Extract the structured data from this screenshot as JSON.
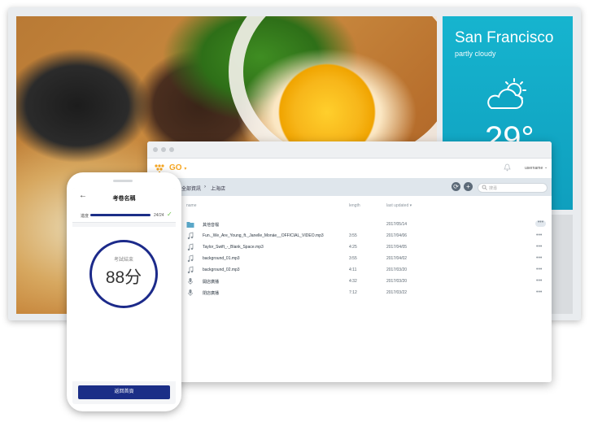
{
  "weather": {
    "city": "San Francisco",
    "condition": "partly cloudy",
    "temperature": "29°",
    "icon": "partly-cloudy-icon"
  },
  "window": {
    "app_name": "GO",
    "username": "username",
    "breadcrumb": [
      "全部資訊",
      "上海店"
    ],
    "search_placeholder": "搜尋",
    "columns": {
      "name": "name",
      "length": "length",
      "updated": "last updated ▾"
    },
    "files": [
      {
        "icon": "folder-icon",
        "name": "其他音檔",
        "length": "",
        "date": "2017/05/14"
      },
      {
        "icon": "music-note-icon",
        "name": "Fun._We_Are_Young_ft._Janelle_Monáe__OFFICIAL_VIDEO.mp3",
        "length": "3:55",
        "date": "2017/04/06"
      },
      {
        "icon": "music-note-icon",
        "name": "Taylor_Swift_-_Blank_Space.mp3",
        "length": "4:25",
        "date": "2017/04/05"
      },
      {
        "icon": "music-note-icon",
        "name": "background_01.mp3",
        "length": "3:55",
        "date": "2017/04/02"
      },
      {
        "icon": "music-note-icon",
        "name": "background_02.mp3",
        "length": "4:11",
        "date": "2017/03/20"
      },
      {
        "icon": "microphone-icon",
        "name": "開店廣播",
        "length": "4:32",
        "date": "2017/03/20"
      },
      {
        "icon": "microphone-icon",
        "name": "閉店廣播",
        "length": "7:12",
        "date": "2017/03/22"
      }
    ],
    "more": "•••",
    "colors": {
      "accent": "#f5a623",
      "crumb_bg": "#dfe6ec"
    }
  },
  "phone": {
    "title": "考卷名稱",
    "progress_label": "進度",
    "progress_count": "24/24",
    "progress_fraction": 1.0,
    "result_label": "考試結束",
    "score": "88分",
    "button": "返回首頁",
    "colors": {
      "primary": "#1b2e87",
      "check": "#6cc24a"
    }
  }
}
